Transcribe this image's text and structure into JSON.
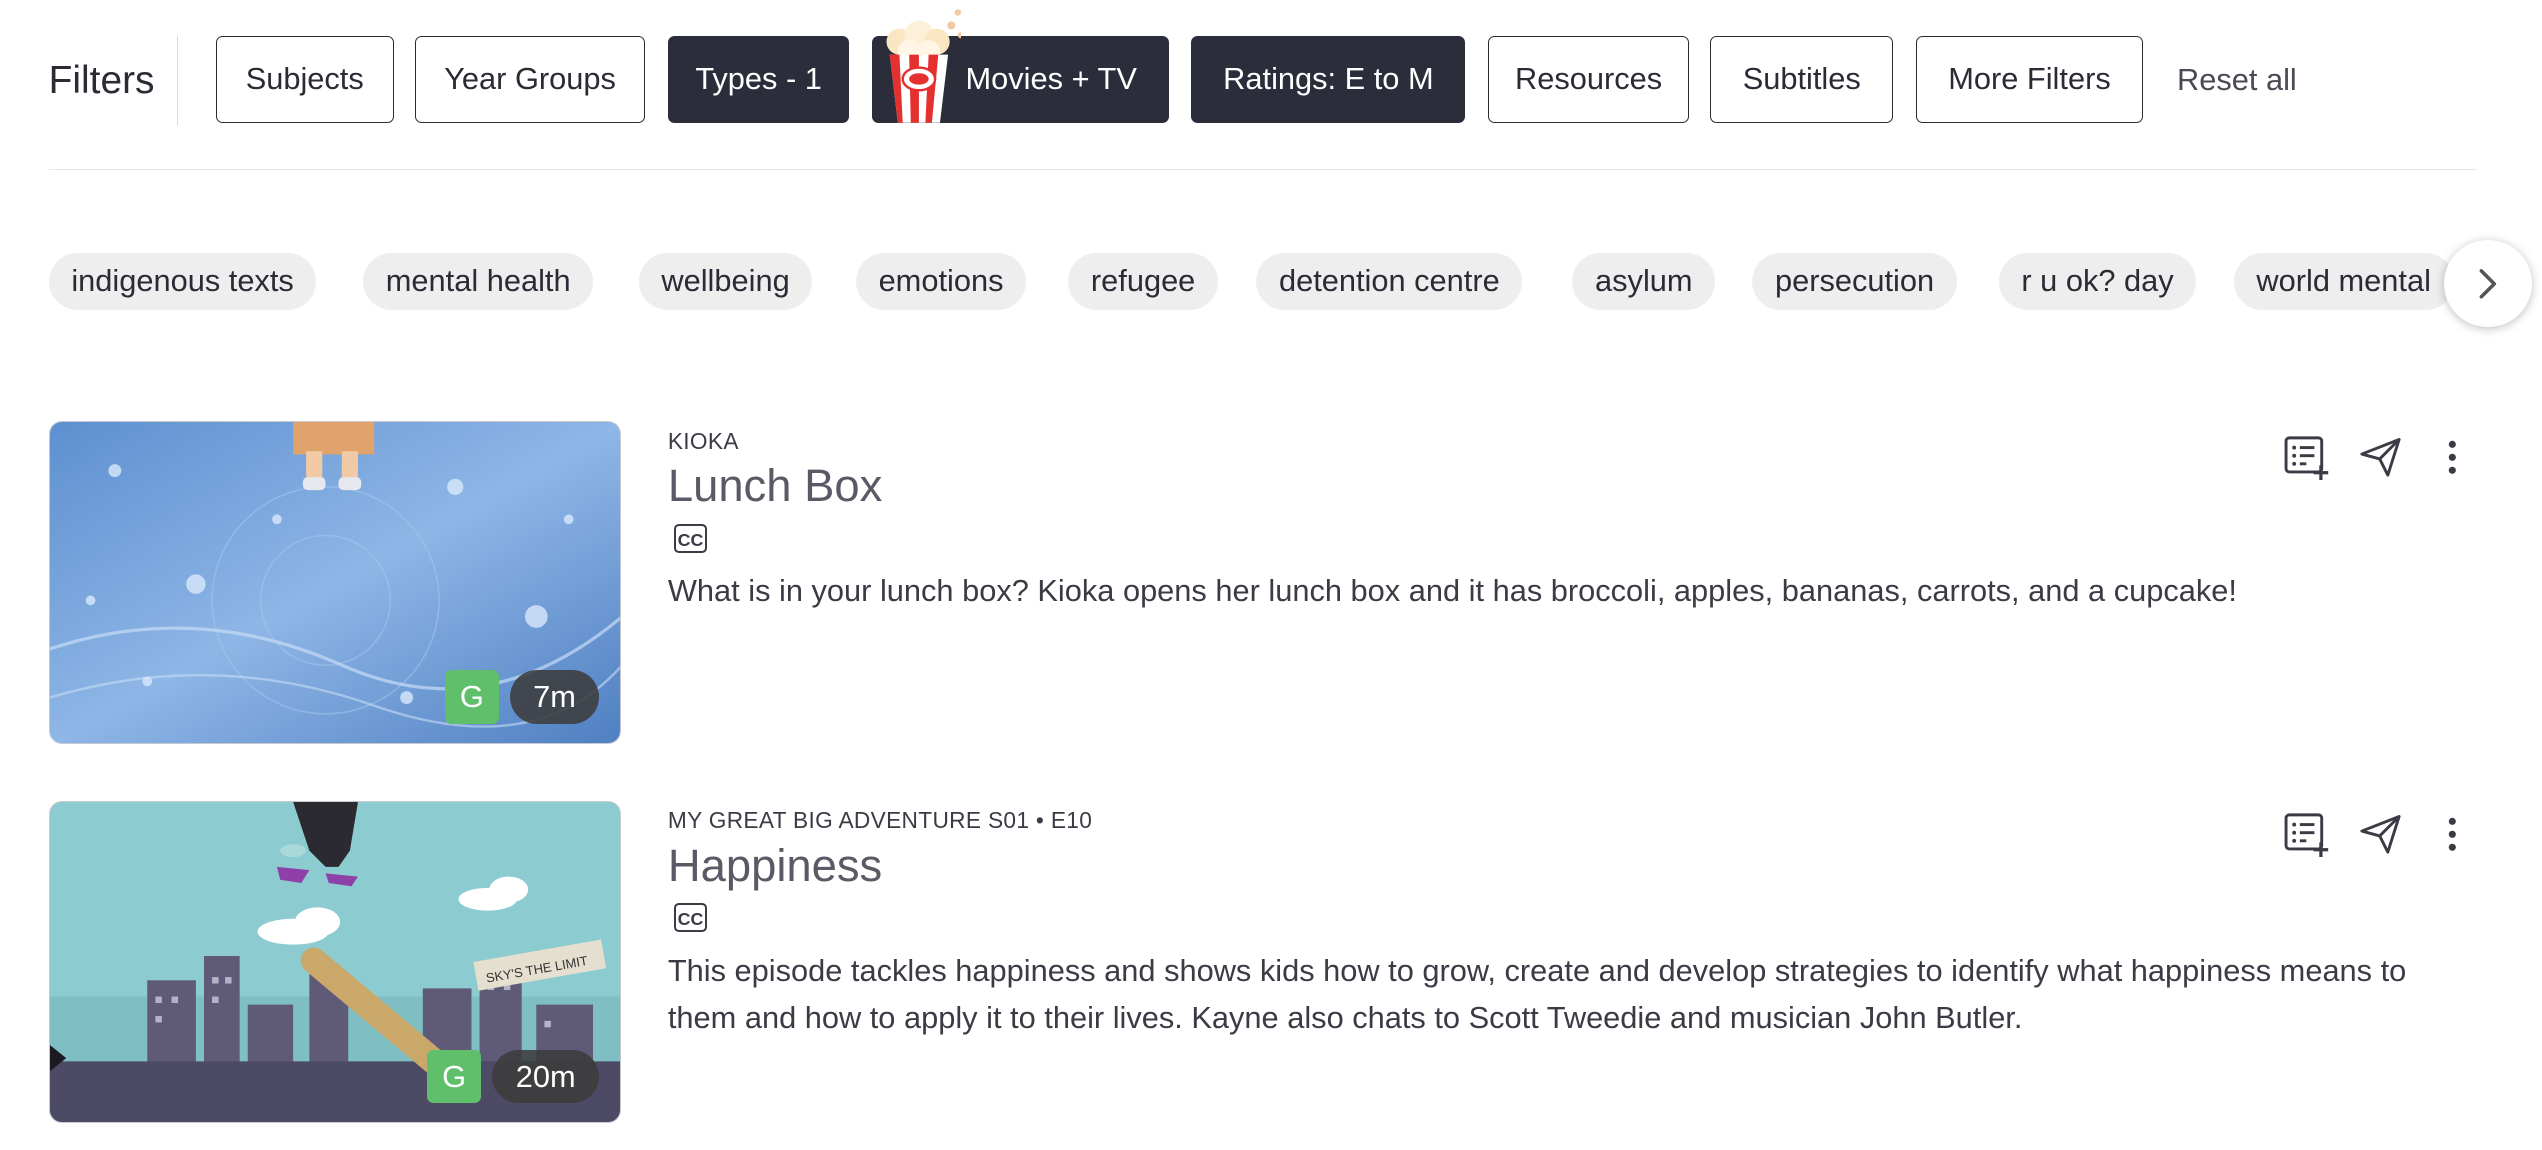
{
  "filters": {
    "title": "Filters",
    "buttons": [
      {
        "label": "Subjects",
        "active": false
      },
      {
        "label": "Year Groups",
        "active": false
      },
      {
        "label": "Types - 1",
        "active": true
      },
      {
        "label": "Movies + TV",
        "active": true
      },
      {
        "label": "Ratings: E to M",
        "active": true
      },
      {
        "label": "Resources",
        "active": false
      },
      {
        "label": "Subtitles",
        "active": false
      },
      {
        "label": "More Filters",
        "active": false
      }
    ],
    "reset_label": "Reset all"
  },
  "tags": [
    "indigenous texts",
    "mental health",
    "wellbeing",
    "emotions",
    "refugee",
    "detention centre",
    "asylum",
    "persecution",
    "r u ok? day",
    "world mental"
  ],
  "results": [
    {
      "series": "KIOKA",
      "title": "Lunch Box",
      "cc_label": "CC",
      "description": "What is in your lunch box? Kioka opens her lunch box and it has broccoli, apples, bananas, carrots, and a cupcake!",
      "rating": "G",
      "duration": "7m"
    },
    {
      "series": "MY GREAT BIG ADVENTURE S01 • E10",
      "title": "Happiness",
      "cc_label": "CC",
      "description": "This episode tackles happiness and shows kids how to grow, create and develop strategies to identify what happiness means to them and how to apply it to their lives. Kayne also chats to Scott Tweedie and musician John Butler.",
      "rating": "G",
      "duration": "20m",
      "thumb_sign": "SKY'S THE LIMIT"
    }
  ],
  "colors": {
    "dark_button": "#2b2d3b",
    "rating_green": "#5fbf6a"
  }
}
